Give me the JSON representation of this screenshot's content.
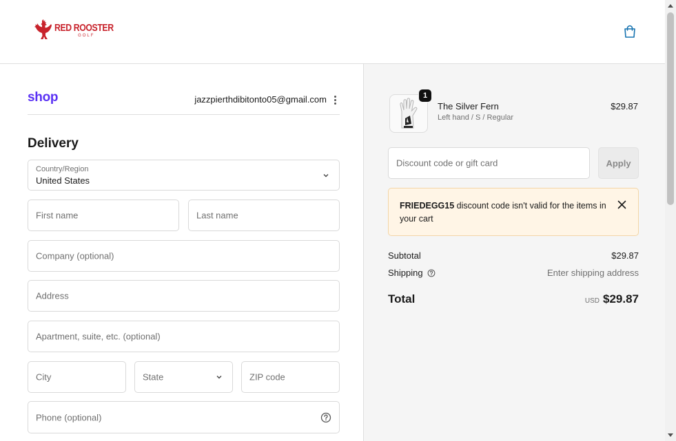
{
  "header": {
    "logo_main": "RED ROOSTER",
    "logo_sub": "GOLF",
    "cart_icon": "shopping-bag-icon",
    "brand_color": "#c8232c"
  },
  "account": {
    "shop_logo": "shop",
    "email": "jazzpierthdibitonto05@gmail.com",
    "shop_color": "#5a31f4"
  },
  "delivery": {
    "heading": "Delivery",
    "country_label": "Country/Region",
    "country_value": "United States",
    "first_name_placeholder": "First name",
    "last_name_placeholder": "Last name",
    "company_placeholder": "Company (optional)",
    "address_placeholder": "Address",
    "apartment_placeholder": "Apartment, suite, etc. (optional)",
    "city_placeholder": "City",
    "state_placeholder": "State",
    "zip_placeholder": "ZIP code",
    "phone_placeholder": "Phone (optional)"
  },
  "order": {
    "item": {
      "quantity": "1",
      "name": "The Silver Fern",
      "variant": "Left hand / S / Regular",
      "price": "$29.87"
    },
    "discount_placeholder": "Discount code or gift card",
    "apply_label": "Apply",
    "notice": {
      "code": "FRIEDEGG15",
      "message": " discount code isn't valid for the items in your cart"
    },
    "subtotal_label": "Subtotal",
    "subtotal_value": "$29.87",
    "shipping_label": "Shipping",
    "shipping_value": "Enter shipping address",
    "total_label": "Total",
    "total_currency": "USD",
    "total_value": "$29.87"
  }
}
